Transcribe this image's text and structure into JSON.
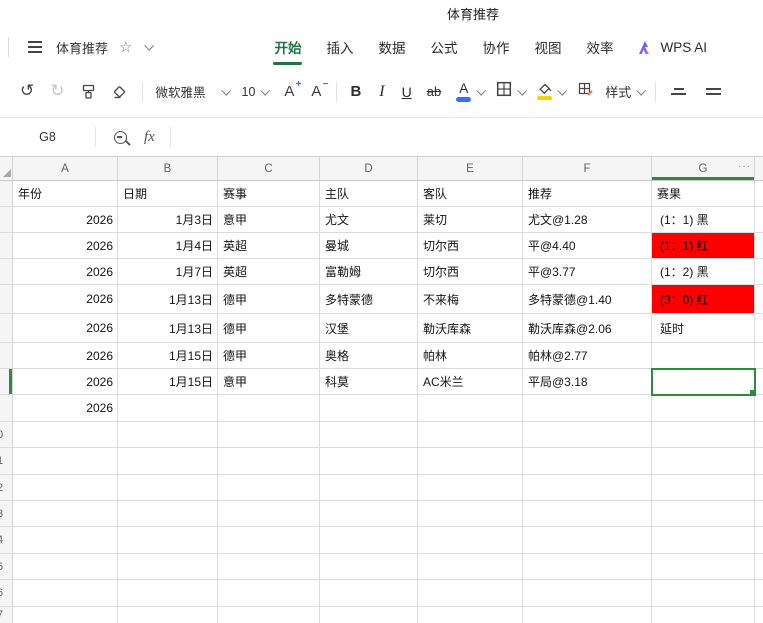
{
  "window": {
    "title": "体育推荐"
  },
  "menu_bar": {
    "doc_title": "体育推荐",
    "tabs": [
      {
        "label": "开始",
        "active": true
      },
      {
        "label": "插入",
        "active": false
      },
      {
        "label": "数据",
        "active": false
      },
      {
        "label": "公式",
        "active": false
      },
      {
        "label": "协作",
        "active": false
      },
      {
        "label": "视图",
        "active": false
      },
      {
        "label": "效率",
        "active": false
      }
    ],
    "wps_ai_label": "WPS AI"
  },
  "toolbar": {
    "font_name": "微软雅黑",
    "font_size": "10",
    "font_grow_label": "A",
    "font_grow_sign": "+",
    "font_shrink_label": "A",
    "font_shrink_sign": "−",
    "bold_label": "B",
    "italic_label": "I",
    "underline_label": "U",
    "strikethrough_label": "ab",
    "font_color_label": "A",
    "style_label": "样式",
    "undo_glyph": "↺",
    "redo_glyph": "↻"
  },
  "formula_bar": {
    "cell_ref": "G8",
    "fx_label": "fx",
    "formula_value": ""
  },
  "sheet": {
    "column_headers": [
      "A",
      "B",
      "C",
      "D",
      "E",
      "F",
      "G"
    ],
    "header_ellipsis": "···",
    "selected_cell": "G8",
    "row_number_fragments": [
      "0",
      "1",
      "2",
      "3",
      "4",
      "5",
      "6",
      "7"
    ],
    "rows": [
      {
        "cells": [
          "年份",
          "日期",
          "赛事",
          "主队",
          "客队",
          "推荐",
          "赛果"
        ],
        "result_style": "plain"
      },
      {
        "cells": [
          "2026",
          "1月3日",
          "意甲",
          "尤文",
          "莱切",
          "尤文@1.28",
          "(1：1) 黑"
        ],
        "result_style": "plain"
      },
      {
        "cells": [
          "2026",
          "1月4日",
          "英超",
          "曼城",
          "切尔西",
          "平@4.40",
          "(1：1) 红"
        ],
        "result_style": "red"
      },
      {
        "cells": [
          "2026",
          "1月7日",
          "英超",
          "富勒姆",
          "切尔西",
          "平@3.77",
          "(1：2) 黑"
        ],
        "result_style": "plain"
      },
      {
        "cells": [
          "2026",
          "1月13日",
          "德甲",
          "多特蒙德",
          "不来梅",
          "多特蒙德@1.40",
          "(3：0) 红"
        ],
        "result_style": "red"
      },
      {
        "cells": [
          "2026",
          "1月13日",
          "德甲",
          "汉堡",
          "勒沃库森",
          "勒沃库森@2.06",
          "延时"
        ],
        "result_style": "plain"
      },
      {
        "cells": [
          "2026",
          "1月15日",
          "德甲",
          "奥格",
          "帕林",
          "帕林@2.77",
          ""
        ],
        "result_style": "plain"
      },
      {
        "cells": [
          "2026",
          "1月15日",
          "意甲",
          "科莫",
          "AC米兰",
          "平局@3.18",
          ""
        ],
        "result_style": "selected"
      },
      {
        "cells": [
          "2026",
          "",
          "",
          "",
          "",
          "",
          ""
        ],
        "result_style": "plain"
      }
    ]
  },
  "colors": {
    "accent_green": "#217346",
    "selection_green": "#2e8a3d",
    "result_red": "#ff0000",
    "font_color_blue": "#3c6cf0",
    "fill_yellow": "#f0d412"
  }
}
